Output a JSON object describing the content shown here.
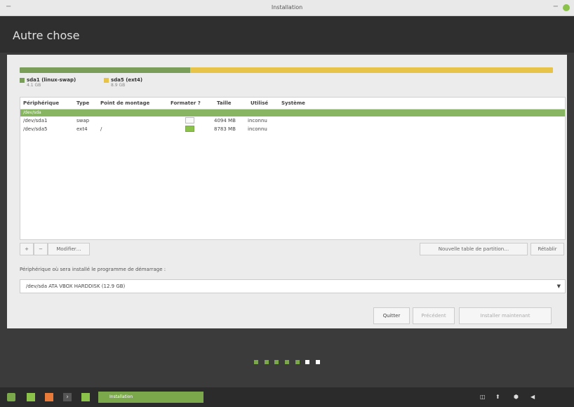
{
  "window": {
    "title": "Installation"
  },
  "header": {
    "heading": "Autre chose"
  },
  "partition_bar": {
    "legend": [
      {
        "label": "sda1 (linux-swap)",
        "size": "4.1 GB",
        "color": "#7a9e5a"
      },
      {
        "label": "sda5 (ext4)",
        "size": "8.9 GB",
        "color": "#e8c34a"
      }
    ]
  },
  "table": {
    "headers": [
      "Périphérique",
      "Type",
      "Point de montage",
      "Formater ?",
      "Taille",
      "Utilisé",
      "Système"
    ],
    "group": "/dev/sda",
    "rows": [
      {
        "device": "/dev/sda1",
        "type": "swap",
        "mount": "",
        "format": false,
        "size": "4094 MB",
        "used": "inconnu"
      },
      {
        "device": "/dev/sda5",
        "type": "ext4",
        "mount": "/",
        "format": true,
        "size": "8783 MB",
        "used": "inconnu"
      }
    ]
  },
  "toolbar": {
    "add": "+",
    "remove": "−",
    "modify": "Modifier…",
    "new_table": "Nouvelle table de partition…",
    "revert": "Rétablir"
  },
  "boot": {
    "label": "Périphérique où sera installé le programme de démarrage :",
    "value": "/dev/sda   ATA VBOX HARDDISK (12.9 GB)"
  },
  "actions": {
    "quit": "Quitter",
    "back": "Précédent",
    "install": "Installer maintenant"
  },
  "progress": {
    "total_steps": 7,
    "current_step": 6
  },
  "taskbar": {
    "app_label": "Installation"
  },
  "colors": {
    "accent": "#87b561",
    "swap": "#7a9e5a",
    "ext4": "#e8c34a"
  }
}
